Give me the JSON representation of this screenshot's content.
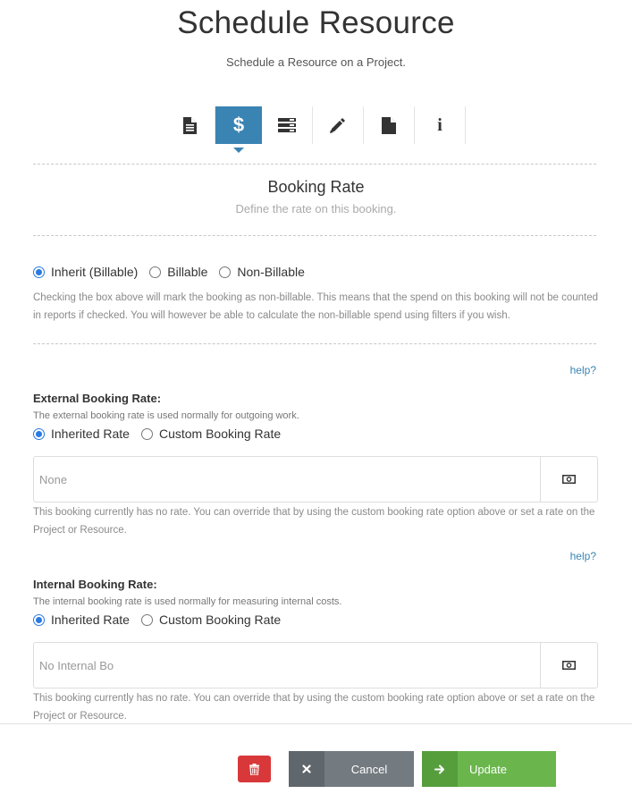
{
  "header": {
    "title": "Schedule Resource",
    "subtitle": "Schedule a Resource on a Project."
  },
  "tabs": [
    {
      "icon": "document-icon",
      "active": false
    },
    {
      "icon": "dollar-icon",
      "label": "$",
      "active": true
    },
    {
      "icon": "list-icon",
      "active": false
    },
    {
      "icon": "pencil-icon",
      "active": false
    },
    {
      "icon": "file-icon",
      "active": false
    },
    {
      "icon": "info-icon",
      "label": "i",
      "active": false
    }
  ],
  "section": {
    "title": "Booking Rate",
    "subtitle": "Define the rate on this booking."
  },
  "billing": {
    "options": [
      "Inherit (Billable)",
      "Billable",
      "Non-Billable"
    ],
    "selected": "Inherit (Billable)",
    "help_text": "Checking the box above will mark the booking as non-billable. This means that the spend on this booking will not be counted in reports if checked. You will however be able to calculate the non-billable spend using filters if you wish."
  },
  "external": {
    "help_link": "help?",
    "label": "External Booking Rate:",
    "description": "The external booking rate is used normally for outgoing work.",
    "options": [
      "Inherited Rate",
      "Custom Booking Rate"
    ],
    "selected": "Inherited Rate",
    "placeholder": "None",
    "addon_icon": "money-icon",
    "help_text": "This booking currently has no rate. You can override that by using the custom booking rate option above or set a rate on the Project or Resource."
  },
  "internal": {
    "help_link": "help?",
    "label": "Internal Booking Rate:",
    "description": "The internal booking rate is used normally for measuring internal costs.",
    "options": [
      "Inherited Rate",
      "Custom Booking Rate"
    ],
    "selected": "Inherited Rate",
    "placeholder": "No Internal Bo",
    "addon_icon": "money-icon",
    "help_text": "This booking currently has no rate. You can override that by using the custom booking rate option above or set a rate on the Project or Resource."
  },
  "footer": {
    "delete_icon": "trash-icon",
    "cancel_icon": "x-icon",
    "cancel_label": "Cancel",
    "update_icon": "arrow-right-icon",
    "update_label": "Update"
  },
  "colors": {
    "accent": "#3a84b4",
    "radio": "#2a7ae2",
    "delete": "#d9383a",
    "cancel": "#737a80",
    "update": "#6ab64d"
  }
}
